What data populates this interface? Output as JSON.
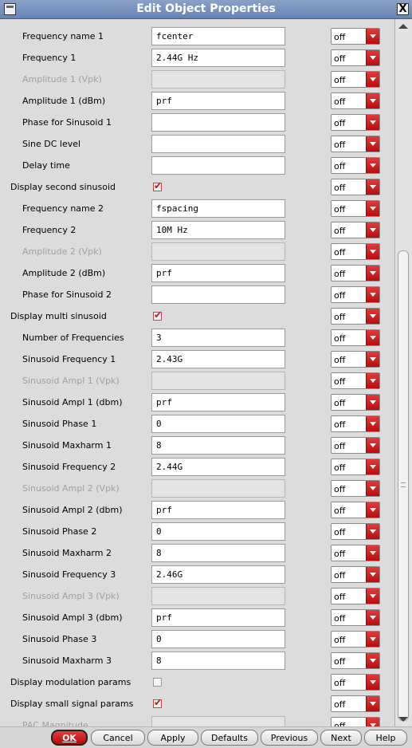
{
  "window": {
    "title": "Edit Object Properties",
    "close_glyph": "X"
  },
  "dropdown_value": "off",
  "rows": [
    {
      "label": "Frequency name 1",
      "kind": "field",
      "value": "fcenter",
      "level": "sub",
      "disabled": false,
      "dropdown": "off"
    },
    {
      "label": "Frequency 1",
      "kind": "field",
      "value": "2.44G Hz",
      "level": "sub",
      "disabled": false,
      "dropdown": "off"
    },
    {
      "label": "Amplitude 1 (Vpk)",
      "kind": "field",
      "value": "",
      "level": "sub",
      "disabled": true,
      "dropdown": "off"
    },
    {
      "label": "Amplitude 1 (dBm)",
      "kind": "field",
      "value": "prf",
      "level": "sub",
      "disabled": false,
      "dropdown": "off"
    },
    {
      "label": "Phase for Sinusoid 1",
      "kind": "field",
      "value": "",
      "level": "sub",
      "disabled": false,
      "dropdown": "off"
    },
    {
      "label": "Sine DC level",
      "kind": "field",
      "value": "",
      "level": "sub",
      "disabled": false,
      "dropdown": "off"
    },
    {
      "label": "Delay time",
      "kind": "field",
      "value": "",
      "level": "sub",
      "disabled": false,
      "dropdown": "off"
    },
    {
      "label": "Display second sinusoid",
      "kind": "check",
      "checked": true,
      "level": "top",
      "disabled": false,
      "dropdown": "off"
    },
    {
      "label": "Frequency name 2",
      "kind": "field",
      "value": "fspacing",
      "level": "sub",
      "disabled": false,
      "dropdown": "off"
    },
    {
      "label": "Frequency 2",
      "kind": "field",
      "value": "10M Hz",
      "level": "sub",
      "disabled": false,
      "dropdown": "off"
    },
    {
      "label": "Amplitude 2 (Vpk)",
      "kind": "field",
      "value": "",
      "level": "sub",
      "disabled": true,
      "dropdown": "off"
    },
    {
      "label": "Amplitude 2 (dBm)",
      "kind": "field",
      "value": "prf",
      "level": "sub",
      "disabled": false,
      "dropdown": "off"
    },
    {
      "label": "Phase for Sinusoid 2",
      "kind": "field",
      "value": "",
      "level": "sub",
      "disabled": false,
      "dropdown": "off"
    },
    {
      "label": "Display multi sinusoid",
      "kind": "check",
      "checked": true,
      "level": "top",
      "disabled": false,
      "dropdown": "off"
    },
    {
      "label": "Number of Frequencies",
      "kind": "field",
      "value": "3",
      "level": "sub",
      "disabled": false,
      "dropdown": "off"
    },
    {
      "label": "Sinusoid Frequency 1",
      "kind": "field",
      "value": "2.43G",
      "level": "sub",
      "disabled": false,
      "dropdown": "off"
    },
    {
      "label": "Sinusoid Ampl 1 (Vpk)",
      "kind": "field",
      "value": "",
      "level": "sub",
      "disabled": true,
      "dropdown": "off"
    },
    {
      "label": "Sinusoid Ampl 1 (dbm)",
      "kind": "field",
      "value": "prf",
      "level": "sub",
      "disabled": false,
      "dropdown": "off"
    },
    {
      "label": "Sinusoid Phase 1",
      "kind": "field",
      "value": "0",
      "level": "sub",
      "disabled": false,
      "dropdown": "off"
    },
    {
      "label": "Sinusoid Maxharm 1",
      "kind": "field",
      "value": "8",
      "level": "sub",
      "disabled": false,
      "dropdown": "off"
    },
    {
      "label": "Sinusoid Frequency 2",
      "kind": "field",
      "value": "2.44G",
      "level": "sub",
      "disabled": false,
      "dropdown": "off"
    },
    {
      "label": "Sinusoid Ampl 2 (Vpk)",
      "kind": "field",
      "value": "",
      "level": "sub",
      "disabled": true,
      "dropdown": "off"
    },
    {
      "label": "Sinusoid Ampl 2 (dbm)",
      "kind": "field",
      "value": "prf",
      "level": "sub",
      "disabled": false,
      "dropdown": "off"
    },
    {
      "label": "Sinusoid Phase 2",
      "kind": "field",
      "value": "0",
      "level": "sub",
      "disabled": false,
      "dropdown": "off"
    },
    {
      "label": "Sinusoid Maxharm 2",
      "kind": "field",
      "value": "8",
      "level": "sub",
      "disabled": false,
      "dropdown": "off"
    },
    {
      "label": "Sinusoid Frequency 3",
      "kind": "field",
      "value": "2.46G",
      "level": "sub",
      "disabled": false,
      "dropdown": "off"
    },
    {
      "label": "Sinusoid Ampl 3 (Vpk)",
      "kind": "field",
      "value": "",
      "level": "sub",
      "disabled": true,
      "dropdown": "off"
    },
    {
      "label": "Sinusoid Ampl 3 (dbm)",
      "kind": "field",
      "value": "prf",
      "level": "sub",
      "disabled": false,
      "dropdown": "off"
    },
    {
      "label": "Sinusoid Phase 3",
      "kind": "field",
      "value": "0",
      "level": "sub",
      "disabled": false,
      "dropdown": "off"
    },
    {
      "label": "Sinusoid Maxharm 3",
      "kind": "field",
      "value": "8",
      "level": "sub",
      "disabled": false,
      "dropdown": "off"
    },
    {
      "label": "Display modulation params",
      "kind": "check",
      "checked": false,
      "level": "top",
      "disabled": false,
      "dropdown": "off"
    },
    {
      "label": "Display small signal params",
      "kind": "check",
      "checked": true,
      "level": "top",
      "disabled": false,
      "dropdown": "off"
    },
    {
      "label": "PAC Magnitude",
      "kind": "field",
      "value": "",
      "level": "sub",
      "disabled": true,
      "dropdown": "off"
    }
  ],
  "buttons": {
    "ok": "OK",
    "cancel": "Cancel",
    "apply": "Apply",
    "defaults": "Defaults",
    "previous": "Previous",
    "next": "Next",
    "help": "Help"
  },
  "colors": {
    "accent_red": "#c41010",
    "titlebar": "#7792c0"
  }
}
